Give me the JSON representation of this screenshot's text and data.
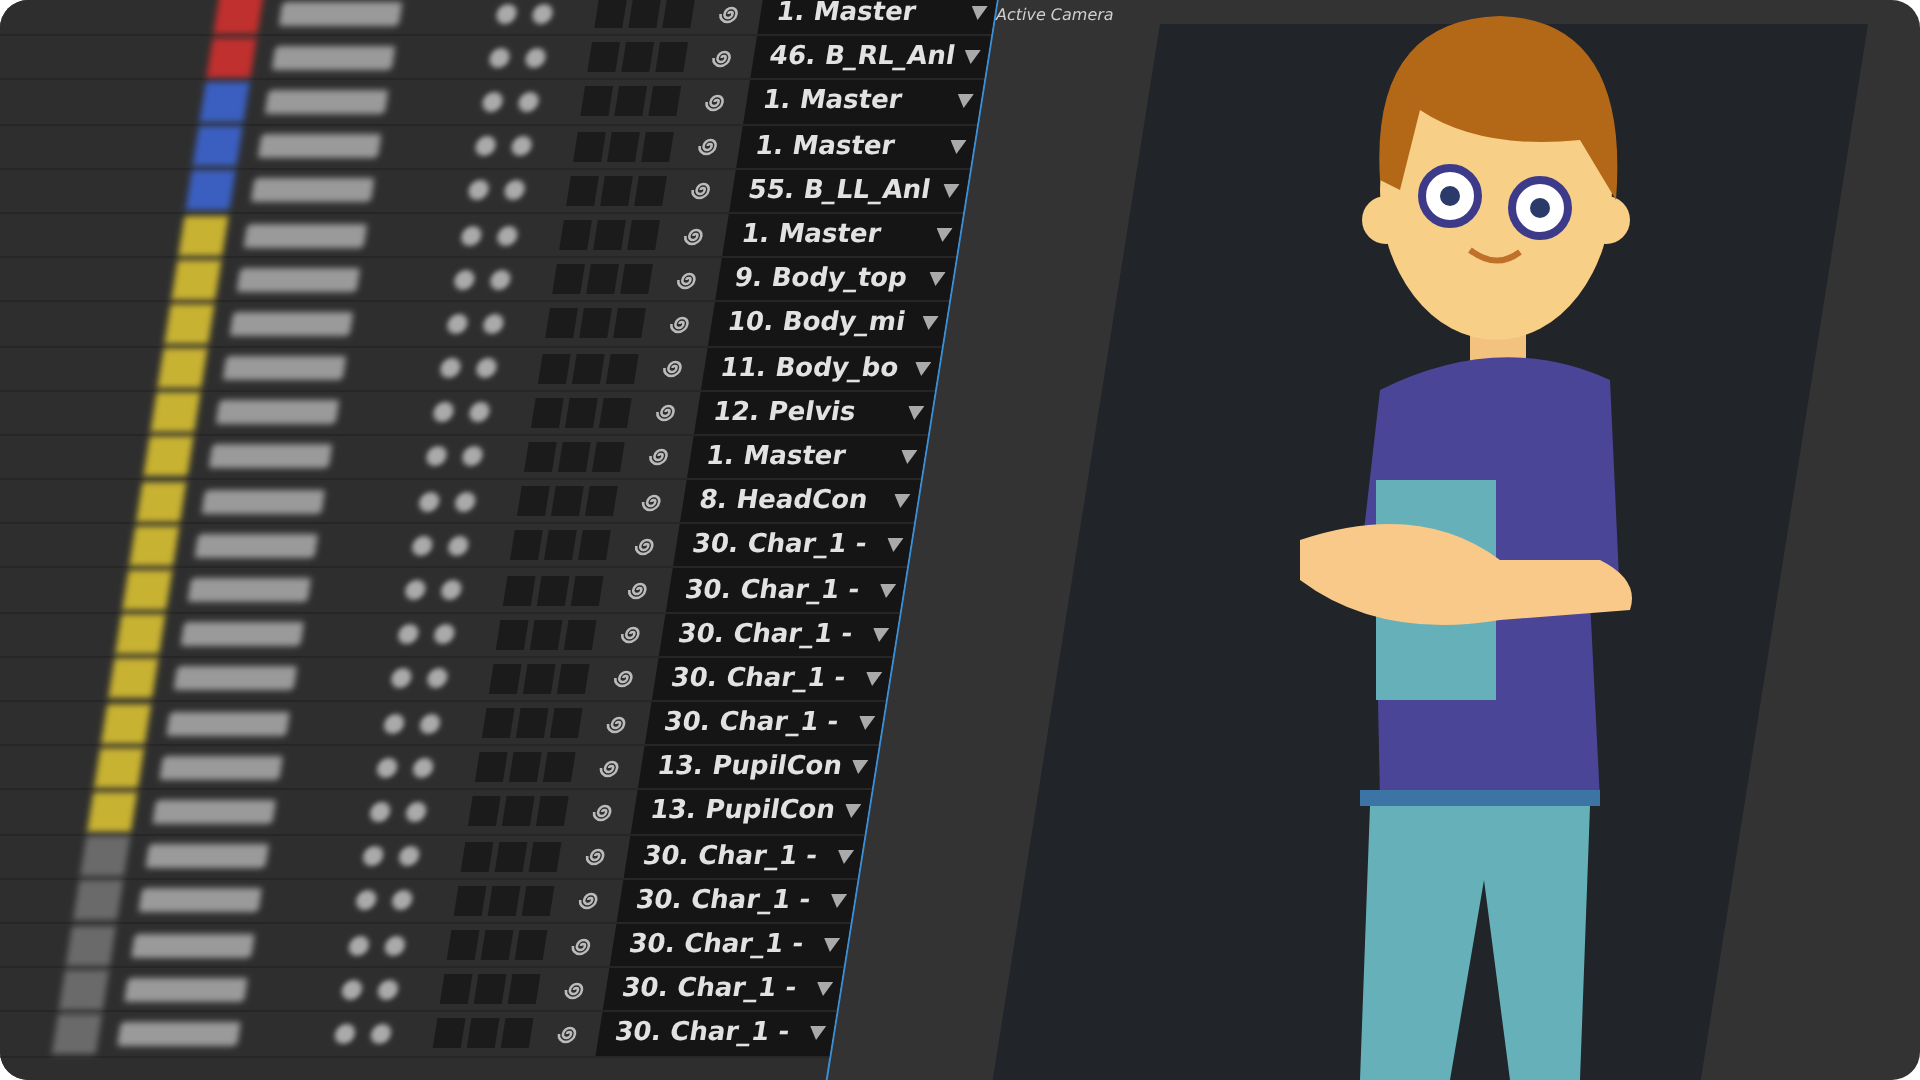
{
  "timeline": {
    "layers": [
      {
        "color": "#c0302e",
        "parent": "1. Master"
      },
      {
        "color": "#c0302e",
        "parent": "46. B_RL_Anl"
      },
      {
        "color": "#3b5fc0",
        "parent": "1. Master"
      },
      {
        "color": "#3b5fc0",
        "parent": "1. Master"
      },
      {
        "color": "#3b5fc0",
        "parent": "55. B_LL_Anl"
      },
      {
        "color": "#c8b232",
        "parent": "1. Master"
      },
      {
        "color": "#c8b232",
        "parent": "9. Body_top"
      },
      {
        "color": "#c8b232",
        "parent": "10. Body_mi"
      },
      {
        "color": "#c8b232",
        "parent": "11. Body_bo"
      },
      {
        "color": "#c8b232",
        "parent": "12. Pelvis"
      },
      {
        "color": "#c8b232",
        "parent": "1. Master"
      },
      {
        "color": "#c8b232",
        "parent": "8. HeadCon"
      },
      {
        "color": "#c8b232",
        "parent": "30. Char_1 -"
      },
      {
        "color": "#c8b232",
        "parent": "30. Char_1 -"
      },
      {
        "color": "#c8b232",
        "parent": "30. Char_1 -"
      },
      {
        "color": "#c8b232",
        "parent": "30. Char_1 -"
      },
      {
        "color": "#c8b232",
        "parent": "30. Char_1 -"
      },
      {
        "color": "#c8b232",
        "parent": "13. PupilCon"
      },
      {
        "color": "#c8b232",
        "parent": "13. PupilCon"
      },
      {
        "color": "#6a6a6a",
        "parent": "30. Char_1 -"
      },
      {
        "color": "#6a6a6a",
        "parent": "30. Char_1 -"
      },
      {
        "color": "#6a6a6a",
        "parent": "30. Char_1 -"
      },
      {
        "color": "#6a6a6a",
        "parent": "30. Char_1 -"
      },
      {
        "color": "#6a6a6a",
        "parent": "30. Char_1 -"
      }
    ]
  },
  "viewer": {
    "title": "Active Camera"
  }
}
